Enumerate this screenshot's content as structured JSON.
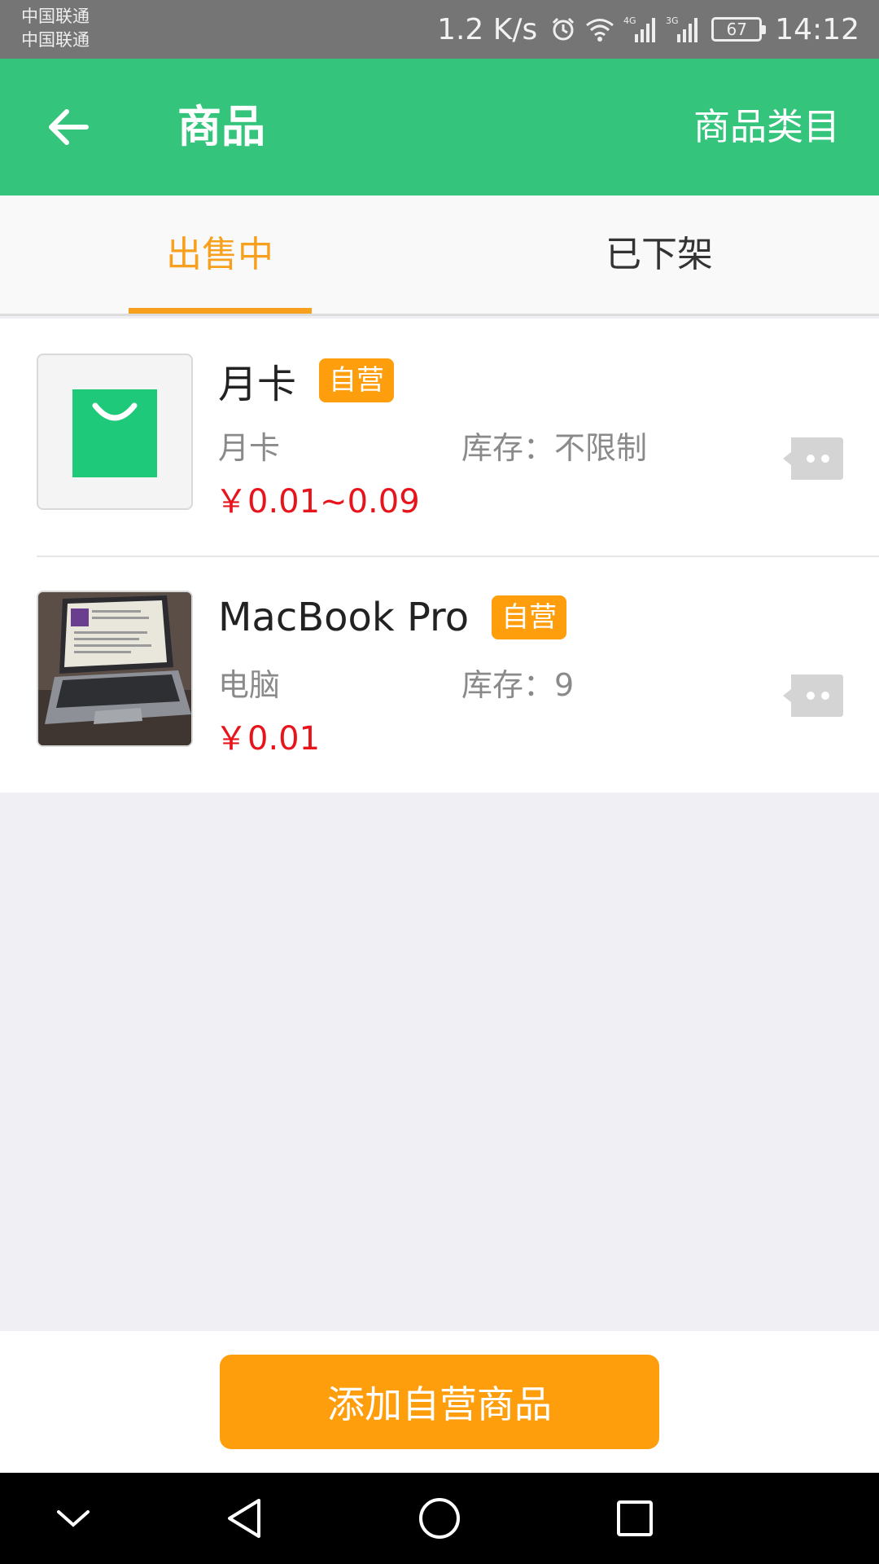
{
  "status_bar": {
    "carrier_1": "中国联通",
    "carrier_2": "中国联通",
    "speed": "1.2 K/s",
    "signal_1_label": "4G",
    "signal_2_label": "3G",
    "battery": "67",
    "time": "14:12"
  },
  "header": {
    "title": "商品",
    "right_link": "商品类目",
    "background": "#34c47c"
  },
  "tabs": [
    {
      "label": "出售中",
      "active": true
    },
    {
      "label": "已下架",
      "active": false
    }
  ],
  "products": [
    {
      "name": "月卡",
      "tag": "自营",
      "subtitle": "月卡",
      "stock": "库存：不限制",
      "price": "￥0.01~0.09",
      "thumbnail_icon": "shopping-bag-icon"
    },
    {
      "name": "MacBook Pro",
      "tag": "自营",
      "subtitle": "电脑",
      "stock": "库存：9",
      "price": "￥0.01",
      "thumbnail_icon": "laptop-photo"
    }
  ],
  "actions": {
    "add_button": "添加自营商品"
  },
  "colors": {
    "accent_orange": "#ff9e0d",
    "price_red": "#e8141c",
    "tab_active": "#f7a01e"
  }
}
